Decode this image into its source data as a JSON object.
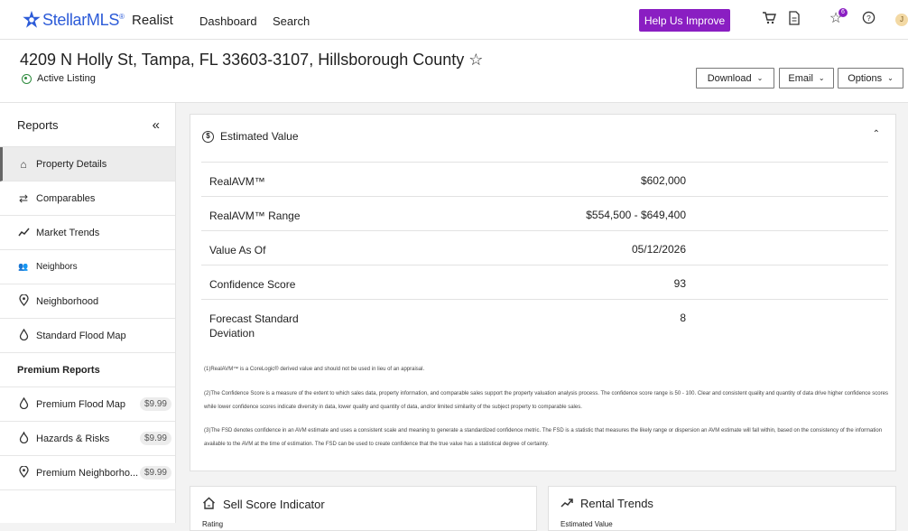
{
  "topnav": {
    "logo_text": "StellarMLS",
    "logo_sup": "®",
    "app_name": "Realist",
    "links": [
      "Dashboard",
      "Search"
    ],
    "help_button": "Help Us Improve",
    "favorites_badge": "6",
    "avatar_initial": "J",
    "brand_color": "#8a1ec2"
  },
  "header": {
    "address": "4209 N Holly St, Tampa, FL 33603-3107, Hillsborough County ☆",
    "status": "Active Listing",
    "buttons": [
      "Download",
      "Email",
      "Options"
    ]
  },
  "sidebar": {
    "title": "Reports",
    "collapse_glyph": "«",
    "items": [
      {
        "label": "Property Details",
        "icon": "home-icon"
      },
      {
        "label": "Comparables",
        "icon": "swap-icon"
      },
      {
        "label": "Market Trends",
        "icon": "trend-icon"
      },
      {
        "label": "Neighbors",
        "icon": "people-icon"
      },
      {
        "label": "Neighborhood",
        "icon": "location-pin-icon"
      },
      {
        "label": "Standard Flood Map",
        "icon": "drop-icon"
      }
    ],
    "premium_title": "Premium Reports",
    "premium_items": [
      {
        "label": "Premium Flood Map",
        "price": "$9.99",
        "icon": "drop-icon"
      },
      {
        "label": "Hazards & Risks",
        "price": "$9.99",
        "icon": "fire-icon"
      },
      {
        "label": "Premium Neighborho...",
        "price": "$9.99",
        "icon": "location-pin-icon"
      }
    ]
  },
  "estimated_value": {
    "title": "Estimated Value",
    "rows": [
      {
        "label": "RealAVM™",
        "value": "$602,000"
      },
      {
        "label": "RealAVM™ Range",
        "value": "$554,500 - $649,400"
      },
      {
        "label": "Value As Of",
        "value": "05/12/2026"
      },
      {
        "label": "Confidence Score",
        "value": "93"
      },
      {
        "label": "Forecast Standard Deviation",
        "value": "8"
      }
    ],
    "footnotes": [
      "(1)RealAVM™ is a CoreLogic® derived value and should not be used in lieu of an appraisal.",
      "(2)The Confidence Score is a measure of the extent to which sales data, property information, and comparable sales support the property valuation analysis process. The confidence score range is 50 - 100. Clear and consistent quality and quantity of data drive higher confidence scores while lower confidence scores indicate diversity in data, lower quality and quantity of data, and/or limited similarity of the subject property to comparable sales.",
      "(3)The FSD denotes confidence in an AVM estimate and uses a consistent scale and meaning to generate a standardized confidence metric. The FSD is a statistic that measures the likely range or dispersion an AVM estimate will fall within, based on the consistency of the information available to the AVM at the time of estimation. The FSD can be used to create confidence that the true value has a statistical degree of certainty."
    ]
  },
  "sell_score": {
    "title": "Sell Score Indicator",
    "sub": "Rating"
  },
  "rental_trends": {
    "title": "Rental Trends",
    "sub": "Estimated Value"
  }
}
